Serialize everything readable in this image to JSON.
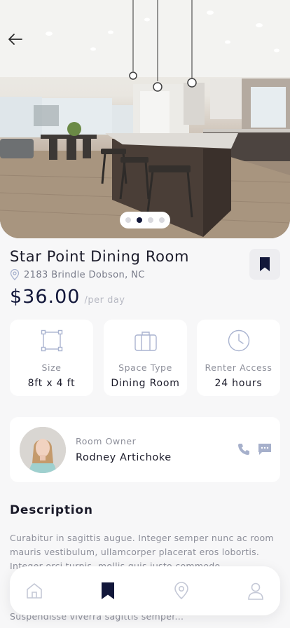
{
  "listing": {
    "title": "Star Point Dining Room",
    "address": "2183 Brindle Dobson, NC",
    "price": "$36.00",
    "price_unit": "/per day"
  },
  "carousel": {
    "slide_count": 4,
    "active_index": 1
  },
  "features": [
    {
      "icon": "size-icon",
      "label": "Size",
      "value": "8ft x 4 ft"
    },
    {
      "icon": "briefcase-icon",
      "label": "Space Type",
      "value": "Dining Room"
    },
    {
      "icon": "clock-icon",
      "label": "Renter Access",
      "value": "24 hours"
    }
  ],
  "owner": {
    "role": "Room Owner",
    "name": "Rodney Artichoke"
  },
  "description": {
    "heading": "Description",
    "text": "Curabitur in sagittis augue. Integer semper nunc ac room mauris vestibulum, ullamcorper placerat eros lobortis. Integer orci turpis, mollis quis justo commodo,",
    "trailing": "Suspendisse viverra sagittis semper..."
  },
  "nav": {
    "items": [
      "home-icon",
      "bookmark-icon",
      "location-icon",
      "profile-icon"
    ],
    "active": "bookmark-icon"
  },
  "colors": {
    "accent": "#12173a",
    "muted": "#8d8f9a",
    "background": "#f7f7f8",
    "card": "#ffffff"
  }
}
